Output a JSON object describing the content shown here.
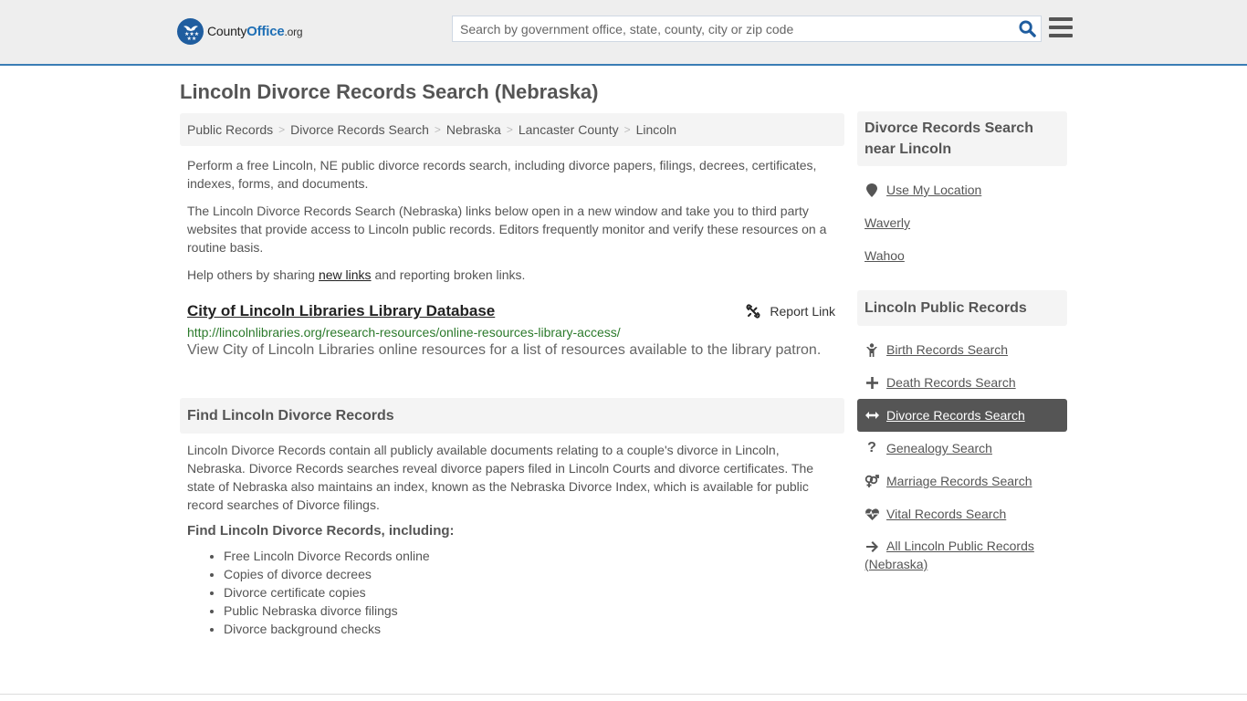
{
  "header": {
    "logo": {
      "county": "County",
      "office": "Office",
      "org": ".org"
    },
    "search": {
      "placeholder": "Search by government office, state, county, city or zip code",
      "value": ""
    },
    "colors": {
      "accent": "#3a7db5",
      "brand": "#1f5d9f"
    }
  },
  "page": {
    "title": "Lincoln Divorce Records Search (Nebraska)"
  },
  "breadcrumb": [
    {
      "label": "Public Records"
    },
    {
      "label": "Divorce Records Search"
    },
    {
      "label": "Nebraska"
    },
    {
      "label": "Lancaster County"
    },
    {
      "label": "Lincoln"
    }
  ],
  "breadcrumb_sep": ">",
  "intro": {
    "p1": "Perform a free Lincoln, NE public divorce records search, including divorce papers, filings, decrees, certificates, indexes, forms, and documents.",
    "p2": "The Lincoln Divorce Records Search (Nebraska) links below open in a new window and take you to third party websites that provide access to Lincoln public records. Editors frequently monitor and verify these resources on a routine basis.",
    "p3_before": "Help others by sharing ",
    "p3_link": "new links",
    "p3_after": " and reporting broken links."
  },
  "resource": {
    "title": "City of Lincoln Libraries Library Database",
    "report_label": "Report Link",
    "url": "http://lincolnlibraries.org/research-resources/online-resources-library-access/",
    "description": "View City of Lincoln Libraries online resources for a list of resources available to the library patron."
  },
  "find_section": {
    "header": "Find Lincoln Divorce Records",
    "body": "Lincoln Divorce Records contain all publicly available documents relating to a couple's divorce in Lincoln, Nebraska. Divorce Records searches reveal divorce papers filed in Lincoln Courts and divorce certificates. The state of Nebraska also maintains an index, known as the Nebraska Divorce Index, which is available for public record searches of Divorce filings.",
    "subheading": "Find Lincoln Divorce Records, including:",
    "items": [
      "Free Lincoln Divorce Records online",
      "Copies of divorce decrees",
      "Divorce certificate copies",
      "Public Nebraska divorce filings",
      "Divorce background checks"
    ]
  },
  "sidebar": {
    "nearby": {
      "header": "Divorce Records Search near Lincoln",
      "use_location": {
        "label": "Use My Location",
        "icon": "map-marker-icon"
      },
      "places": [
        "Waverly",
        "Wahoo"
      ]
    },
    "public_records": {
      "header": "Lincoln Public Records",
      "items": [
        {
          "label": "Birth Records Search",
          "icon": "child-icon",
          "active": false
        },
        {
          "label": "Death Records Search",
          "icon": "plus-icon",
          "active": false
        },
        {
          "label": "Divorce Records Search",
          "icon": "arrows-horizontal-icon",
          "active": true
        },
        {
          "label": "Genealogy Search",
          "icon": "question-icon",
          "active": false
        },
        {
          "label": "Marriage Records Search",
          "icon": "venus-mars-icon",
          "active": false
        },
        {
          "label": "Vital Records Search",
          "icon": "heartbeat-icon",
          "active": false
        },
        {
          "label": "All Lincoln Public Records (Nebraska)",
          "icon": "arrow-right-icon",
          "active": false
        }
      ]
    }
  }
}
